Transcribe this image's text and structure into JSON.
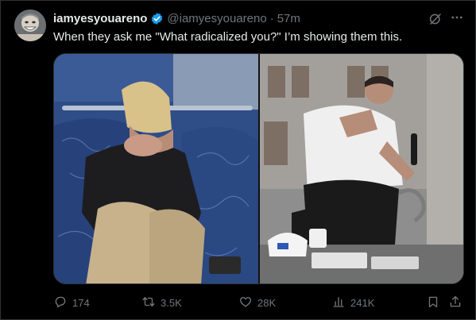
{
  "tweet": {
    "display_name": "iamyesyouareno",
    "handle": "@iamyesyouareno",
    "separator": "·",
    "time": "57m",
    "text": "When they ask me \"What radicalized you?\" I’m showing them this."
  },
  "actions": {
    "replies": "174",
    "reposts": "3.5K",
    "likes": "28K",
    "views": "241K"
  },
  "colors": {
    "background": "#000000",
    "text": "#e7e9ea",
    "secondary": "#71767b",
    "verified": "#1d9bf0",
    "border": "#2f3336"
  },
  "icons": [
    "verified-badge-icon",
    "grok-icon",
    "more-icon",
    "reply-icon",
    "retweet-icon",
    "like-icon",
    "views-icon",
    "bookmark-icon",
    "share-icon"
  ]
}
